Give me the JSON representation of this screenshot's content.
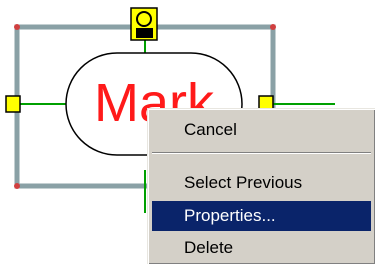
{
  "diagram": {
    "node_label": "Mark",
    "colors": {
      "label": "#ff1a1a",
      "frame": "#8aa1a6",
      "handle": "#ffff00",
      "connector": "#00a000",
      "oval": "#000000",
      "corner": "#d04040"
    }
  },
  "context_menu": {
    "items": [
      {
        "label": "Cancel",
        "highlighted": false
      },
      {
        "label": "Select Previous",
        "highlighted": false
      },
      {
        "label": "Properties...",
        "highlighted": true
      },
      {
        "label": "Delete",
        "highlighted": false
      }
    ],
    "colors": {
      "background": "#d4d0c8",
      "highlight": "#0a246a"
    }
  }
}
